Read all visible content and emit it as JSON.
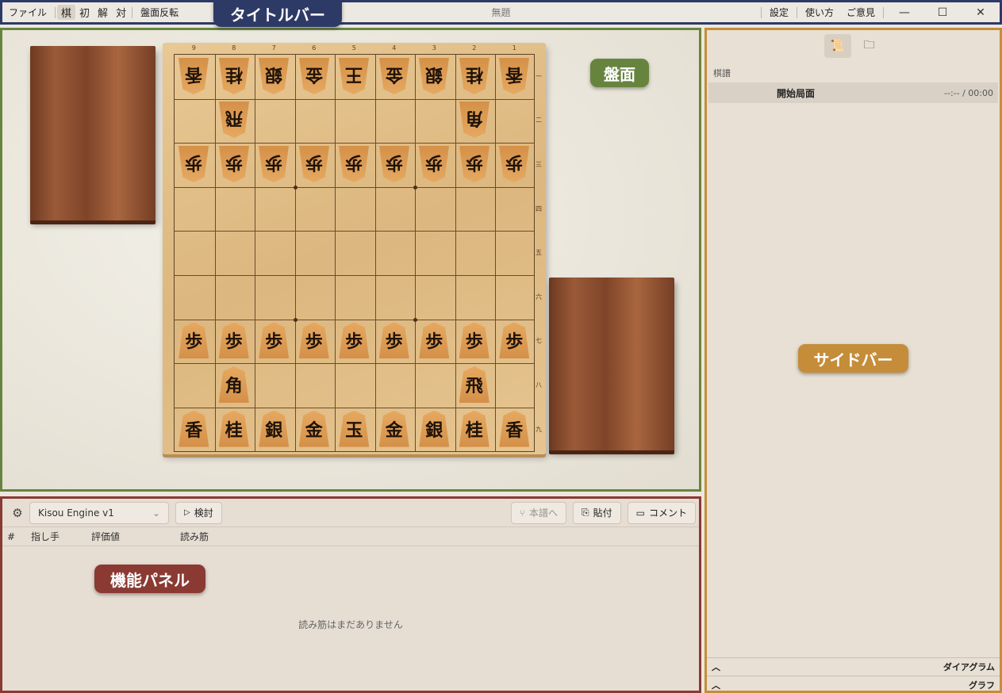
{
  "titlebar": {
    "menu_file": "ファイル",
    "modes": [
      "棋",
      "初",
      "解",
      "対"
    ],
    "flip_board": "盤面反転",
    "title": "無題",
    "settings": "設定",
    "help": "使い方",
    "feedback": "ご意見",
    "minimize_glyph": "—",
    "maximize_glyph": "☐",
    "close_glyph": "✕"
  },
  "callouts": {
    "titlebar": "タイトルバー",
    "board": "盤面",
    "sidebar": "サイドバー",
    "panel": "機能パネル"
  },
  "board": {
    "file_labels": [
      "9",
      "8",
      "7",
      "6",
      "5",
      "4",
      "3",
      "2",
      "1"
    ],
    "rank_labels": [
      "一",
      "二",
      "三",
      "四",
      "五",
      "六",
      "七",
      "八",
      "九"
    ],
    "pieces": [
      {
        "row": 0,
        "col": 0,
        "label": "香",
        "side": "gote"
      },
      {
        "row": 0,
        "col": 1,
        "label": "桂",
        "side": "gote"
      },
      {
        "row": 0,
        "col": 2,
        "label": "銀",
        "side": "gote"
      },
      {
        "row": 0,
        "col": 3,
        "label": "金",
        "side": "gote"
      },
      {
        "row": 0,
        "col": 4,
        "label": "王",
        "side": "gote"
      },
      {
        "row": 0,
        "col": 5,
        "label": "金",
        "side": "gote"
      },
      {
        "row": 0,
        "col": 6,
        "label": "銀",
        "side": "gote"
      },
      {
        "row": 0,
        "col": 7,
        "label": "桂",
        "side": "gote"
      },
      {
        "row": 0,
        "col": 8,
        "label": "香",
        "side": "gote"
      },
      {
        "row": 1,
        "col": 1,
        "label": "飛",
        "side": "gote"
      },
      {
        "row": 1,
        "col": 7,
        "label": "角",
        "side": "gote"
      },
      {
        "row": 2,
        "col": 0,
        "label": "歩",
        "side": "gote"
      },
      {
        "row": 2,
        "col": 1,
        "label": "歩",
        "side": "gote"
      },
      {
        "row": 2,
        "col": 2,
        "label": "歩",
        "side": "gote"
      },
      {
        "row": 2,
        "col": 3,
        "label": "歩",
        "side": "gote"
      },
      {
        "row": 2,
        "col": 4,
        "label": "歩",
        "side": "gote"
      },
      {
        "row": 2,
        "col": 5,
        "label": "歩",
        "side": "gote"
      },
      {
        "row": 2,
        "col": 6,
        "label": "歩",
        "side": "gote"
      },
      {
        "row": 2,
        "col": 7,
        "label": "歩",
        "side": "gote"
      },
      {
        "row": 2,
        "col": 8,
        "label": "歩",
        "side": "gote"
      },
      {
        "row": 6,
        "col": 0,
        "label": "歩",
        "side": "sente"
      },
      {
        "row": 6,
        "col": 1,
        "label": "歩",
        "side": "sente"
      },
      {
        "row": 6,
        "col": 2,
        "label": "歩",
        "side": "sente"
      },
      {
        "row": 6,
        "col": 3,
        "label": "歩",
        "side": "sente"
      },
      {
        "row": 6,
        "col": 4,
        "label": "歩",
        "side": "sente"
      },
      {
        "row": 6,
        "col": 5,
        "label": "歩",
        "side": "sente"
      },
      {
        "row": 6,
        "col": 6,
        "label": "歩",
        "side": "sente"
      },
      {
        "row": 6,
        "col": 7,
        "label": "歩",
        "side": "sente"
      },
      {
        "row": 6,
        "col": 8,
        "label": "歩",
        "side": "sente"
      },
      {
        "row": 7,
        "col": 1,
        "label": "角",
        "side": "sente"
      },
      {
        "row": 7,
        "col": 7,
        "label": "飛",
        "side": "sente"
      },
      {
        "row": 8,
        "col": 0,
        "label": "香",
        "side": "sente"
      },
      {
        "row": 8,
        "col": 1,
        "label": "桂",
        "side": "sente"
      },
      {
        "row": 8,
        "col": 2,
        "label": "銀",
        "side": "sente"
      },
      {
        "row": 8,
        "col": 3,
        "label": "金",
        "side": "sente"
      },
      {
        "row": 8,
        "col": 4,
        "label": "玉",
        "side": "sente"
      },
      {
        "row": 8,
        "col": 5,
        "label": "金",
        "side": "sente"
      },
      {
        "row": 8,
        "col": 6,
        "label": "銀",
        "side": "sente"
      },
      {
        "row": 8,
        "col": 7,
        "label": "桂",
        "side": "sente"
      },
      {
        "row": 8,
        "col": 8,
        "label": "香",
        "side": "sente"
      }
    ]
  },
  "panel": {
    "engine": "Kisou Engine v1",
    "analyze": "検討",
    "to_main": "本譜へ",
    "paste": "貼付",
    "comment": "コメント",
    "col_num": "#",
    "col_move": "指し手",
    "col_eval": "評価値",
    "col_pv": "読み筋",
    "empty": "読み筋はまだありません"
  },
  "sidebar": {
    "kifu_label": "棋譜",
    "start_position": "開始局面",
    "time": "--:-- / 00:00",
    "diagram": "ダイアグラム",
    "graph": "グラフ"
  },
  "colors": {
    "titlebar_frame": "#2e3a66",
    "board_frame": "#67843f",
    "sidebar_frame": "#c58d3a",
    "panel_frame": "#8a3a33"
  }
}
